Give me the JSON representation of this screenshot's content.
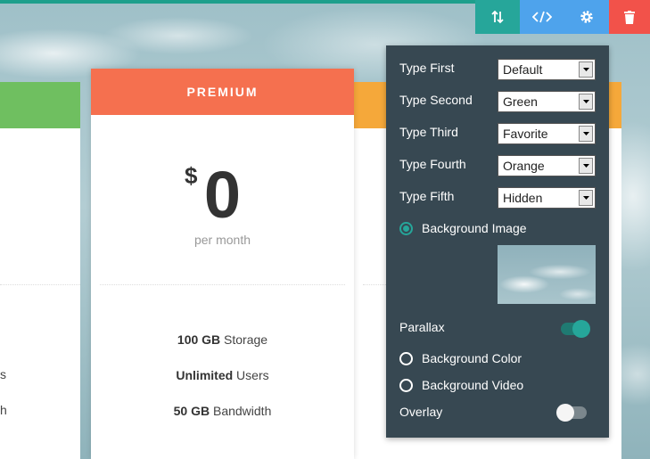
{
  "toolbar": {
    "move_icon": "arrows-up-down-icon",
    "code_icon": "code-icon",
    "gear_icon": "gear-icon",
    "delete_icon": "trash-icon"
  },
  "pricing": {
    "plan_name": "PREMIUM",
    "currency": "$",
    "price": "0",
    "period": "per month",
    "features": [
      {
        "bold": "100 GB",
        "text": " Storage"
      },
      {
        "bold": "Unlimited",
        "text": " Users"
      },
      {
        "bold": "50 GB",
        "text": " Bandwidth"
      }
    ],
    "left_card_fragments": [
      "s",
      "h"
    ]
  },
  "settings": {
    "type_first_label": "Type First",
    "type_first_value": "Default",
    "type_second_label": "Type Second",
    "type_second_value": "Green",
    "type_third_label": "Type Third",
    "type_third_value": "Favorite",
    "type_fourth_label": "Type Fourth",
    "type_fourth_value": "Orange",
    "type_fifth_label": "Type Fifth",
    "type_fifth_value": "Hidden",
    "bg_image_label": "Background Image",
    "parallax_label": "Parallax",
    "parallax_on": true,
    "bg_color_label": "Background Color",
    "bg_video_label": "Background Video",
    "overlay_label": "Overlay",
    "overlay_on": false
  },
  "colors": {
    "accent": "#26a69a",
    "premium_header": "#f5704f",
    "left_header": "#6fbf60",
    "right_header": "#f5a83a",
    "panel_bg": "#374852",
    "delete": "#f2524a",
    "toolbar_blue": "#4ea3ec"
  }
}
